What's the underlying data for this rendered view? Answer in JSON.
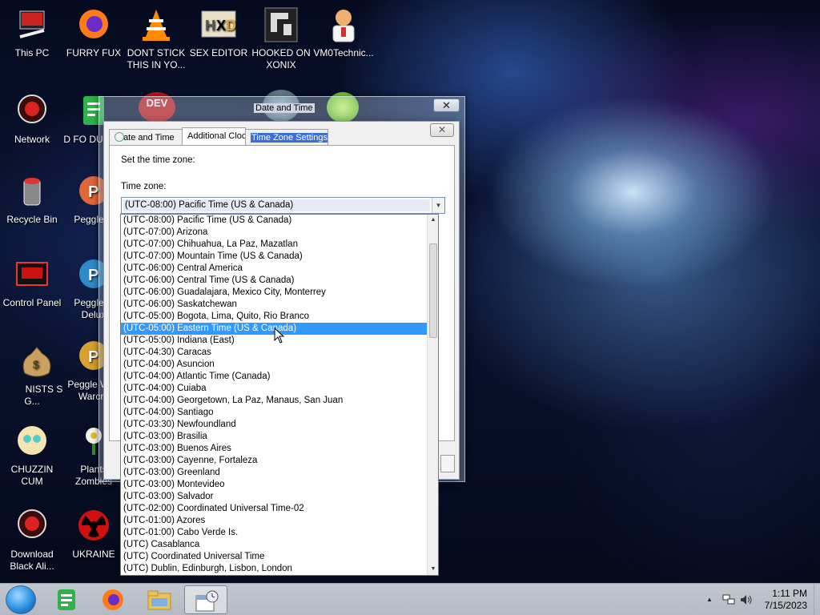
{
  "desktop": {
    "icons": [
      {
        "label": "This PC",
        "icon": "computer-icon"
      },
      {
        "label": "FURRY FUX",
        "icon": "firefox-icon"
      },
      {
        "label": "DONT STICK THIS IN YO...",
        "icon": "vlc-icon"
      },
      {
        "label": "SEX EDITOR",
        "icon": "hxd-icon"
      },
      {
        "label": "HOOKED ON XONIX",
        "icon": "game-icon"
      },
      {
        "label": "VM0Technic...",
        "icon": "doctor-icon"
      },
      {
        "label": "Network",
        "icon": "network-icon"
      },
      {
        "label": "D FO DUMBA",
        "icon": "document-icon"
      },
      {
        "label": "Recycle Bin",
        "icon": "recycle-bin-icon"
      },
      {
        "label": "Peggle D",
        "icon": "peggle-icon"
      },
      {
        "label": "Control Panel",
        "icon": "control-panel-icon"
      },
      {
        "label": "Peggle N Delux",
        "icon": "peggle-icon"
      },
      {
        "label": "NISTS S G...",
        "icon": "money-bag-icon"
      },
      {
        "label": "Peggle W of Warcra",
        "icon": "peggle-icon"
      },
      {
        "label": "CHUZZIN CUM",
        "icon": "cartoon-icon"
      },
      {
        "label": "Plants Zombies",
        "icon": "plant-icon"
      },
      {
        "label": "Download Black Ali...",
        "icon": "download-icon"
      },
      {
        "label": "UKRAINE",
        "icon": "radiation-icon"
      }
    ]
  },
  "bg_window": {
    "title": "Date and Time",
    "close_symbol": "✕"
  },
  "dialog": {
    "close_symbol": "✕",
    "tabs": [
      {
        "label": "ate and Time"
      },
      {
        "label": "Additional Cloc"
      },
      {
        "label_highlight": "Time Zone Settings",
        "label_tail": "e"
      }
    ],
    "set_label": "Set the time zone:",
    "tz_label": "Time zone:",
    "combo_value": "(UTC-08:00) Pacific Time (US & Canada)",
    "combo_arrow": "▼"
  },
  "dropdown": {
    "items": [
      "(UTC-08:00) Pacific Time (US & Canada)",
      "(UTC-07:00) Arizona",
      "(UTC-07:00) Chihuahua, La Paz, Mazatlan",
      "(UTC-07:00) Mountain Time (US & Canada)",
      "(UTC-06:00) Central America",
      "(UTC-06:00) Central Time (US & Canada)",
      "(UTC-06:00) Guadalajara, Mexico City, Monterrey",
      "(UTC-06:00) Saskatchewan",
      "(UTC-05:00) Bogota, Lima, Quito, Rio Branco",
      "(UTC-05:00) Eastern Time (US & Canada)",
      "(UTC-05:00) Indiana (East)",
      "(UTC-04:30) Caracas",
      "(UTC-04:00) Asuncion",
      "(UTC-04:00) Atlantic Time (Canada)",
      "(UTC-04:00) Cuiaba",
      "(UTC-04:00) Georgetown, La Paz, Manaus, San Juan",
      "(UTC-04:00) Santiago",
      "(UTC-03:30) Newfoundland",
      "(UTC-03:00) Brasilia",
      "(UTC-03:00) Buenos Aires",
      "(UTC-03:00) Cayenne, Fortaleza",
      "(UTC-03:00) Greenland",
      "(UTC-03:00) Montevideo",
      "(UTC-03:00) Salvador",
      "(UTC-02:00) Coordinated Universal Time-02",
      "(UTC-01:00) Azores",
      "(UTC-01:00) Cabo Verde Is.",
      "(UTC) Casablanca",
      "(UTC) Coordinated Universal Time",
      "(UTC) Dublin, Edinburgh, Lisbon, London"
    ],
    "selected_index": 9,
    "scroll_up": "▲",
    "scroll_down": "▼"
  },
  "taskbar": {
    "apps": [
      {
        "icon": "notes-icon",
        "active": false
      },
      {
        "icon": "firefox-icon",
        "active": false
      },
      {
        "icon": "file-explorer-icon",
        "active": false
      },
      {
        "icon": "date-time-icon",
        "active": true
      }
    ],
    "tray": {
      "show_hidden": "▲",
      "network": "network-tray-icon",
      "volume": "volume-icon"
    },
    "clock": {
      "time": "1:11 PM",
      "date": "7/15/2023"
    }
  }
}
